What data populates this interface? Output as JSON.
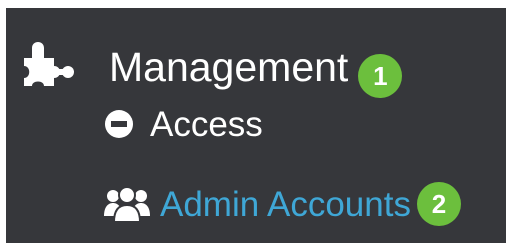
{
  "menu": {
    "management": {
      "label": "Management",
      "icon": "puzzle-piece-icon",
      "callout": "1"
    },
    "access": {
      "label": "Access",
      "icon": "minus-circle-icon"
    },
    "admin_accounts": {
      "label": "Admin Accounts",
      "icon": "users-icon",
      "callout": "2"
    }
  },
  "colors": {
    "panel_background": "#36373b",
    "menu_text": "#ffffff",
    "active_link": "#3fa7d6",
    "callout_badge": "#6cbf3d"
  }
}
